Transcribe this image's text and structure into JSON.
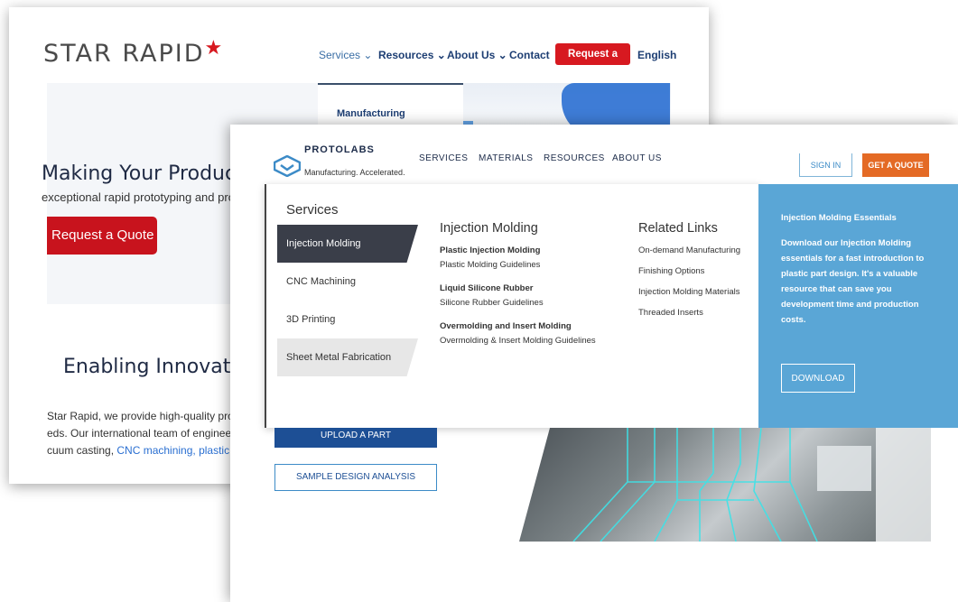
{
  "back_window": {
    "logo_text": "STAR RAPID",
    "nav": {
      "services": "Services ⌄",
      "resources": "Resources ⌄",
      "about": "About Us ⌄",
      "contact": "Contact",
      "quote": "Request a Quote",
      "language": "English"
    },
    "dropdown_item": "Manufacturing",
    "hero_heading": "Making Your Product Ic",
    "hero_sub": "exceptional rapid prototyping and produ",
    "hero_button": "Request a Quote",
    "section_heading": "Enabling Innovation",
    "body_line1": "Star Rapid, we provide high-quality prototy",
    "body_line2": "eds. Our international team of engineers w",
    "body_line3_pre": "cuum casting, ",
    "body_line3_link": "CNC machining, plastic inje"
  },
  "front_window": {
    "logo_name": "PROTOLABS",
    "logo_tagline": "Manufacturing. Accelerated.",
    "top_nav": [
      "SERVICES",
      "MATERIALS",
      "RESOURCES",
      "ABOUT US"
    ],
    "sign_in": "SIGN IN",
    "get_quote": "GET A QUOTE",
    "menu": {
      "title": "Services",
      "services": [
        "Injection Molding",
        "CNC Machining",
        "3D Printing",
        "Sheet Metal Fabrication"
      ],
      "col1_heading": "Injection Molding",
      "col1_links": [
        {
          "title": "Plastic Injection Molding",
          "sub": "Plastic Molding Guidelines"
        },
        {
          "title": "Liquid Silicone Rubber",
          "sub": "Silicone Rubber Guidelines"
        },
        {
          "title": "Overmolding and Insert Molding",
          "sub": "Overmolding & Insert Molding Guidelines"
        }
      ],
      "col2_heading": "Related Links",
      "col2_links": [
        "On-demand Manufacturing",
        "Finishing Options",
        "Injection Molding Materials",
        "Threaded Inserts"
      ],
      "promo_title": "Injection Molding Essentials",
      "promo_text": "Download our Injection Molding essentials for a fast introduction to plastic part design. It's a valuable resource that can save you development time and production costs.",
      "promo_button": "DOWNLOAD"
    },
    "upload_button": "UPLOAD A PART",
    "sample_button": "SAMPLE DESIGN ANALYSIS"
  },
  "colors": {
    "star_red": "#d71920",
    "star_navy": "#1d3e73",
    "protolabs_blue": "#5aa6d6",
    "protolabs_orange": "#e46a25"
  }
}
